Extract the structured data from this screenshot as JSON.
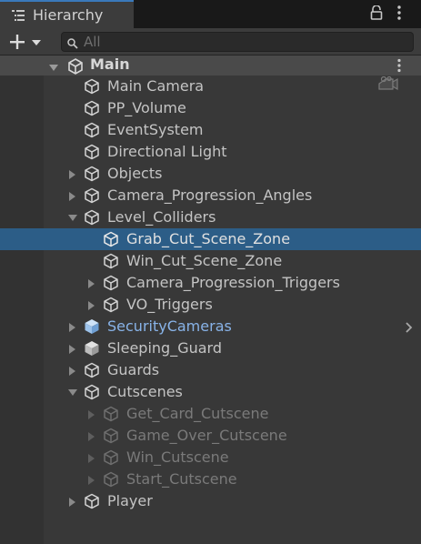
{
  "window": {
    "tab_title": "Hierarchy"
  },
  "toolbar": {
    "search_placeholder": "All"
  },
  "scene": {
    "name": "Main"
  },
  "colors": {
    "selection": "#2c5d87",
    "prefab_text": "#88b3e8",
    "inactive_text": "#7a7a7a",
    "tab_accent": "#3a79bb"
  },
  "rows": [
    {
      "label": "Main Camera",
      "depth": 0,
      "fold": "none",
      "style": "normal",
      "icon": "gameobject-icon"
    },
    {
      "label": "PP_Volume",
      "depth": 0,
      "fold": "none",
      "style": "normal",
      "icon": "gameobject-icon"
    },
    {
      "label": "EventSystem",
      "depth": 0,
      "fold": "none",
      "style": "normal",
      "icon": "gameobject-icon"
    },
    {
      "label": "Directional Light",
      "depth": 0,
      "fold": "none",
      "style": "normal",
      "icon": "gameobject-icon"
    },
    {
      "label": "Objects",
      "depth": 0,
      "fold": "collapsed",
      "style": "normal",
      "icon": "gameobject-icon"
    },
    {
      "label": "Camera_Progression_Angles",
      "depth": 0,
      "fold": "collapsed",
      "style": "normal",
      "icon": "gameobject-icon"
    },
    {
      "label": "Level_Colliders",
      "depth": 0,
      "fold": "expanded",
      "style": "normal",
      "icon": "gameobject-icon"
    },
    {
      "label": "Grab_Cut_Scene_Zone",
      "depth": 1,
      "fold": "none",
      "style": "selected",
      "icon": "gameobject-icon"
    },
    {
      "label": "Win_Cut_Scene_Zone",
      "depth": 1,
      "fold": "none",
      "style": "normal",
      "icon": "gameobject-icon"
    },
    {
      "label": "Camera_Progression_Triggers",
      "depth": 1,
      "fold": "collapsed",
      "style": "normal",
      "icon": "gameobject-icon"
    },
    {
      "label": "VO_Triggers",
      "depth": 1,
      "fold": "collapsed",
      "style": "normal",
      "icon": "gameobject-icon"
    },
    {
      "label": "SecurityCameras",
      "depth": 0,
      "fold": "collapsed",
      "style": "prefab",
      "icon": "prefab-icon",
      "has_chevron": true
    },
    {
      "label": "Sleeping_Guard",
      "depth": 0,
      "fold": "collapsed",
      "style": "normal",
      "icon": "prefab-icon"
    },
    {
      "label": "Guards",
      "depth": 0,
      "fold": "collapsed",
      "style": "normal",
      "icon": "gameobject-icon"
    },
    {
      "label": "Cutscenes",
      "depth": 0,
      "fold": "expanded",
      "style": "normal",
      "icon": "gameobject-icon"
    },
    {
      "label": "Get_Card_Cutscene",
      "depth": 1,
      "fold": "collapsed",
      "style": "inactive",
      "icon": "gameobject-icon"
    },
    {
      "label": "Game_Over_Cutscene",
      "depth": 1,
      "fold": "collapsed",
      "style": "inactive",
      "icon": "gameobject-icon"
    },
    {
      "label": "Win_Cutscene",
      "depth": 1,
      "fold": "collapsed",
      "style": "inactive",
      "icon": "gameobject-icon"
    },
    {
      "label": "Start_Cutscene",
      "depth": 1,
      "fold": "collapsed",
      "style": "inactive",
      "icon": "gameobject-icon"
    },
    {
      "label": "Player",
      "depth": 0,
      "fold": "collapsed",
      "style": "normal",
      "icon": "gameobject-icon"
    }
  ]
}
